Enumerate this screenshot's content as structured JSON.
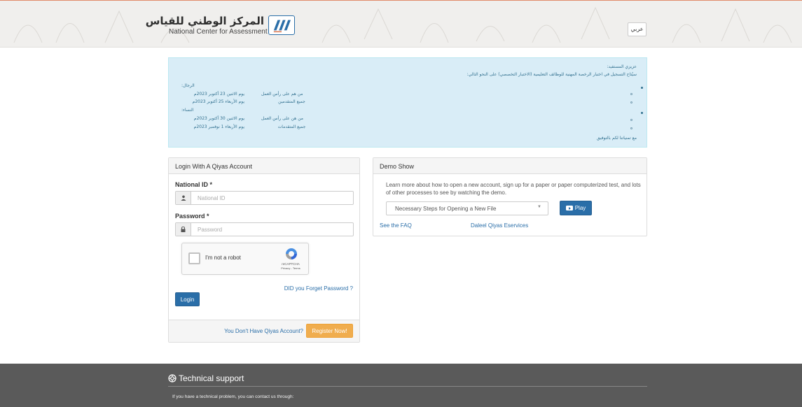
{
  "header": {
    "logo_ar": "المركز الوطني للقياس",
    "logo_en": "National Center for Assessment",
    "lang_button": "عربي"
  },
  "alert": {
    "greeting": "عزيزي المستفيد:",
    "intro": "سيُتاح التسجيل في اختبار الرخصة المهنية للوظائف التعليمية (الاختبار التخصصي) على النحو التالي:",
    "men_label": "الرجال:",
    "men_row1_who": "من هم على رأس العمل",
    "men_row1_date": "يوم الاثنين 23 أكتوبر 2023م",
    "men_row2_who": "جميع المتقدمين",
    "men_row2_date": "يوم الأربعاء 25 أكتوبر 2023م",
    "women_label": "النساء:",
    "women_row1_who": "من هن على رأس العمل",
    "women_row1_date": "يوم الاثنين 30 أكتوبر 2023م",
    "women_row2_who": "جميع المتقدمات",
    "women_row2_date": "يوم الأربعاء 1 نوفمبر 2023م",
    "closing": "مع تمنياتنا لكم بالتوفيق"
  },
  "login": {
    "title": "Login With A Qiyas Account",
    "national_id_label": "National ID",
    "national_id_placeholder": "National ID",
    "password_label": "Password",
    "password_placeholder": "Password",
    "required_mark": "*",
    "captcha_text": "I'm not a robot",
    "captcha_brand": "reCAPTCHA",
    "captcha_terms": "Privacy - Terms",
    "forgot": "DID you Forget Password ?",
    "login_button": "Login",
    "no_account": "You Don't Have Qiyas Account?",
    "register_button": "Register Now!"
  },
  "demo": {
    "title": "Demo Show",
    "description": "Learn more about how to open a new account, sign up for a paper or paper computerized test, and lots of other processes to see by watching the demo.",
    "selected_option": "Necessary Steps for Opening a New File",
    "play_button": "Play",
    "faq_link": "See the FAQ",
    "daleel_link": "Daleel Qiyas Eservices"
  },
  "footer": {
    "title": "Technical support",
    "text": "If you have a technical problem, you can contact us through:"
  },
  "colors": {
    "primary": "#2a6ea8",
    "warning": "#f0ad4e",
    "alert_bg": "#d9edf7",
    "footer_bg": "#5a5a5a"
  }
}
